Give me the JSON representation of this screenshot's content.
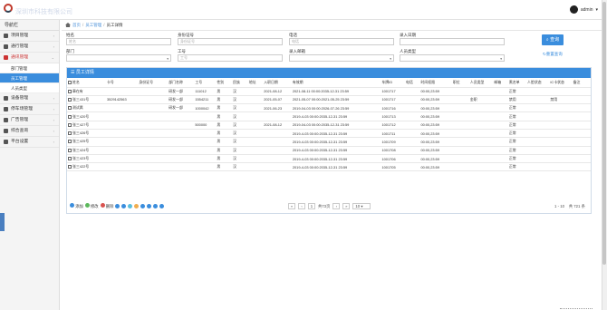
{
  "app": {
    "logo_text": "深圳市科技有限公司",
    "user_name": "admin"
  },
  "sidebar": {
    "title": "导航栏",
    "items": [
      {
        "label": "项目管理",
        "icon": "grid-icon"
      },
      {
        "label": "通行管理",
        "icon": "list-icon"
      },
      {
        "label": "通讯管理",
        "icon": "list-icon",
        "active": true,
        "children": [
          {
            "label": "部门管理",
            "selected": false
          },
          {
            "label": "员工管理",
            "selected": true
          },
          {
            "label": "人员类型",
            "selected": false
          }
        ]
      },
      {
        "label": "设备管理",
        "icon": "box-icon"
      },
      {
        "label": "停车场管理",
        "icon": "car-icon"
      },
      {
        "label": "广告管理",
        "icon": "image-icon"
      },
      {
        "label": "综合查询",
        "icon": "search-icon"
      },
      {
        "label": "平台设置",
        "icon": "gear-icon"
      }
    ]
  },
  "breadcrumb": {
    "home": "首页",
    "section": "员工管理",
    "page": "员工详情"
  },
  "form": {
    "name_label": "姓名",
    "name_placeholder": "姓名",
    "idcard_label": "身份证号",
    "idcard_placeholder": "身份证号",
    "phone_label": "电话",
    "phone_placeholder": "电话",
    "entry_date_label": "录入日期",
    "entry_date_placeholder": "",
    "dept_label": "部门",
    "dept_value": "",
    "empno_label": "工号",
    "empno_placeholder": "工号",
    "recorder_label": "录入邮箱",
    "recorder_value": "",
    "person_type_label": "人员类型",
    "person_type_value": "",
    "search_button": "查询",
    "reset_link": "重置查询"
  },
  "panel_title": "员工详情",
  "table": {
    "columns": [
      "姓名",
      "卡号",
      "身份证号",
      "部门名称",
      "工号",
      "性别",
      "民族",
      "地址",
      "入职日期",
      "有效期",
      "车牌ID",
      "电话",
      "时间权限",
      "职位",
      "人员类型",
      "邮箱",
      "黑名单",
      "人脸状态",
      "IC卡状态",
      "备注"
    ],
    "rows": [
      [
        "章在有",
        "",
        "",
        "研发一部",
        "111012",
        "男",
        "汉",
        "",
        "2021-08-12",
        "2021-08-11 00:00:2035-12-31 23:59",
        "1001717",
        "",
        "00:00,23:59",
        "",
        "",
        "",
        "正常",
        "",
        "",
        ""
      ],
      [
        "张三431号",
        "3529142563",
        "",
        "研发一部",
        "1554211",
        "男",
        "汉",
        "",
        "2021-05-07",
        "2021-05-07 00:00:2021-05-25 23:59",
        "1001717",
        "",
        "00:00,23:59",
        "",
        "金职",
        "",
        "禁用",
        "",
        "禁用",
        ""
      ],
      [
        "测试属",
        "",
        "",
        "研发一部",
        "1000042",
        "男",
        "汉",
        "",
        "2021-06-23",
        "2019-04-03 00:00:2026-07-26 23:59",
        "1001716",
        "",
        "00:00,23:59",
        "",
        "",
        "",
        "正常",
        "",
        "",
        ""
      ],
      [
        "张三420号",
        "",
        "",
        "",
        "",
        "男",
        "汉",
        "",
        "",
        "2019-4-03 00:00:2035-12-31 23:59",
        "1001713",
        "",
        "00:00,23:59",
        "",
        "",
        "",
        "正常",
        "",
        "",
        ""
      ],
      [
        "张三427号",
        "",
        "",
        "",
        "500000",
        "男",
        "汉",
        "",
        "2021-08-12",
        "2019-04-03 00:00:2035-12-31 23:59",
        "1001712",
        "",
        "00:00,23:59",
        "",
        "",
        "",
        "正常",
        "",
        "",
        ""
      ],
      [
        "张三426号",
        "",
        "",
        "",
        "",
        "男",
        "汉",
        "",
        "",
        "2019-4-03 00:00:2035-12-31 23:59",
        "1001711",
        "",
        "00:00,23:59",
        "",
        "",
        "",
        "正常",
        "",
        "",
        ""
      ],
      [
        "张三425号",
        "",
        "",
        "",
        "",
        "男",
        "汉",
        "",
        "",
        "2019-4-03 00:00:2035-12-31 23:59",
        "1001709",
        "",
        "00:00,23:59",
        "",
        "",
        "",
        "正常",
        "",
        "",
        ""
      ],
      [
        "张三424号",
        "",
        "",
        "",
        "",
        "男",
        "汉",
        "",
        "",
        "2019-4-03 00:00:2035-12-31 23:59",
        "1001708",
        "",
        "00:00,23:59",
        "",
        "",
        "",
        "正常",
        "",
        "",
        ""
      ],
      [
        "张三423号",
        "",
        "",
        "",
        "",
        "男",
        "汉",
        "",
        "",
        "2019-4-03 00:00:2035-12-31 23:59",
        "1001706",
        "",
        "00:00,23:59",
        "",
        "",
        "",
        "正常",
        "",
        "",
        ""
      ],
      [
        "张三422号",
        "",
        "",
        "",
        "",
        "男",
        "汉",
        "",
        "",
        "2019-4-03 00:00:2035-12-31 23:59",
        "1001705",
        "",
        "00:00,23:59",
        "",
        "",
        "",
        "正常",
        "",
        "",
        ""
      ]
    ]
  },
  "toolbar": {
    "add": "添加",
    "edit": "修改",
    "delete": "删除"
  },
  "pagination": {
    "page_input": "1",
    "total_pages": "共73页",
    "page_size": "10",
    "range_text": "1 - 10",
    "total_text": "共 721 条"
  },
  "colors": {
    "accent": "#3a8ddd",
    "active_menu": "#cc3333"
  }
}
